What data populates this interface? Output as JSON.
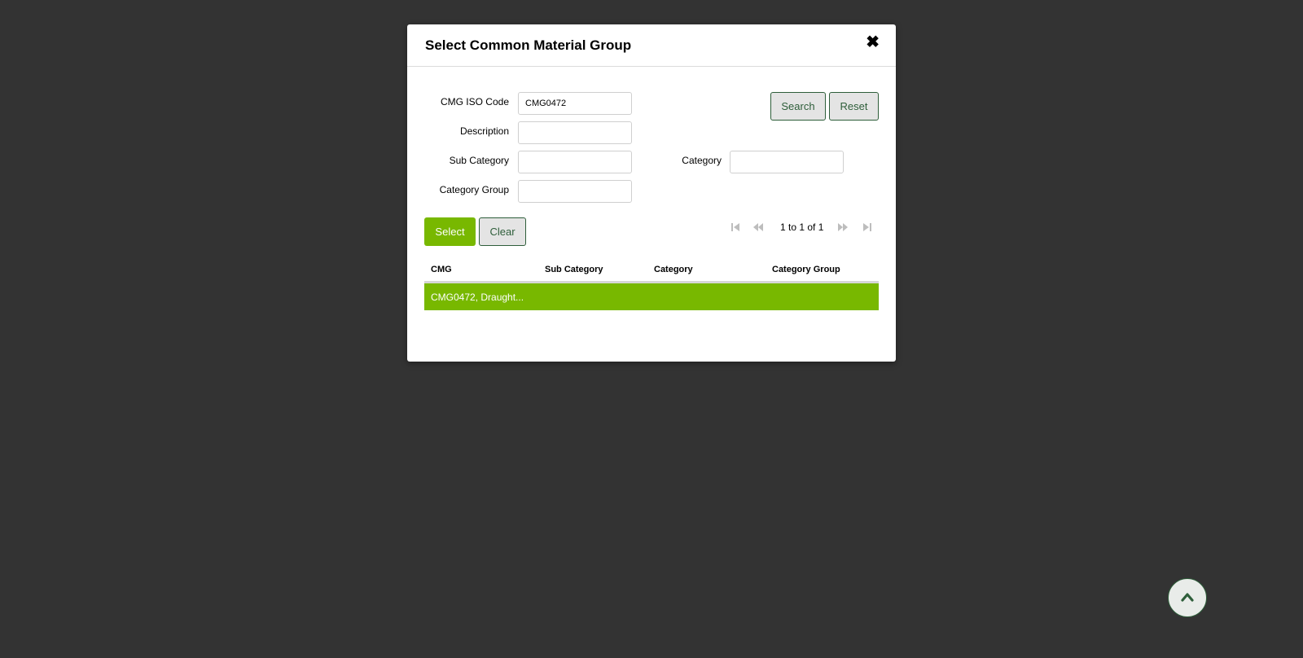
{
  "modal": {
    "title": "Select Common Material Group",
    "close_glyph": "✖"
  },
  "form": {
    "cmg_iso_code": {
      "label": "CMG ISO Code",
      "value": "CMG0472"
    },
    "description": {
      "label": "Description",
      "value": ""
    },
    "sub_category": {
      "label": "Sub Category",
      "value": ""
    },
    "category": {
      "label": "Category",
      "value": ""
    },
    "category_group": {
      "label": "Category Group",
      "value": ""
    }
  },
  "buttons": {
    "search": "Search",
    "reset": "Reset",
    "select": "Select",
    "clear": "Clear"
  },
  "pager": {
    "text": "1 to 1 of 1",
    "icons": [
      "first-page-icon",
      "previous-page-icon",
      "next-page-icon",
      "last-page-icon"
    ]
  },
  "grid": {
    "columns": [
      "CMG",
      "Sub Category",
      "Category",
      "Category Group"
    ],
    "rows": [
      {
        "cmg": "CMG0472, Draught...",
        "sub_category": "",
        "category": "",
        "category_group": ""
      }
    ],
    "selected_row_color": "#78b800"
  },
  "colors": {
    "accent": "#78b800",
    "dark_green": "#2e5e3a",
    "backdrop": "#333333"
  },
  "scroll_top": {
    "icon": "chevron-up-icon"
  }
}
